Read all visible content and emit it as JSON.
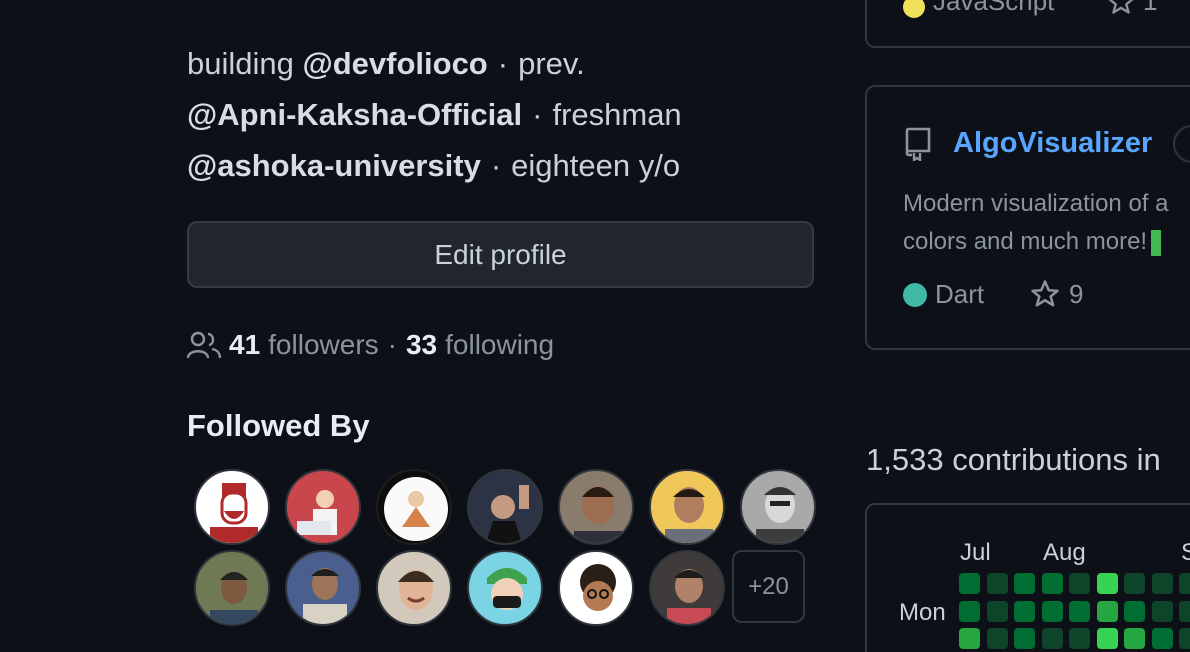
{
  "profile": {
    "bio": {
      "line1": {
        "text1": "building",
        "mention": "@devfolioco",
        "dot": "·",
        "text2": "prev."
      },
      "line2": {
        "mention": "@Apni-Kaksha-Official",
        "dot": "·",
        "text2": "freshman"
      },
      "line3": {
        "mention": "@ashoka-university",
        "dot": "·",
        "text2": "eighteen y/o"
      }
    },
    "edit_button": "Edit profile",
    "followers_count": "41",
    "followers_label": "followers",
    "separator": "·",
    "following_count": "33",
    "following_label": "following",
    "followed_by_title": "Followed By",
    "followed_by_more": "+20"
  },
  "pinned_top": {
    "language": "JavaScript",
    "language_color": "#f1e05a",
    "stars": "1"
  },
  "pinned_repo": {
    "name": "AlgoVisualizer",
    "description_line1": "Modern visualization of a",
    "description_line2": "colors and much more!",
    "language": "Dart",
    "language_color": "#40b8a4",
    "stars": "9"
  },
  "contributions": {
    "title": "1,533 contributions in",
    "months": [
      "Jul",
      "Aug",
      "S"
    ],
    "day_label": "Mon"
  },
  "icons": {
    "people": "people-icon",
    "star": "star-icon",
    "repo": "repo-icon"
  },
  "colors": {
    "background": "#0d1117",
    "link": "#58a6ff",
    "border": "#30363d",
    "button_bg": "#21262d"
  }
}
